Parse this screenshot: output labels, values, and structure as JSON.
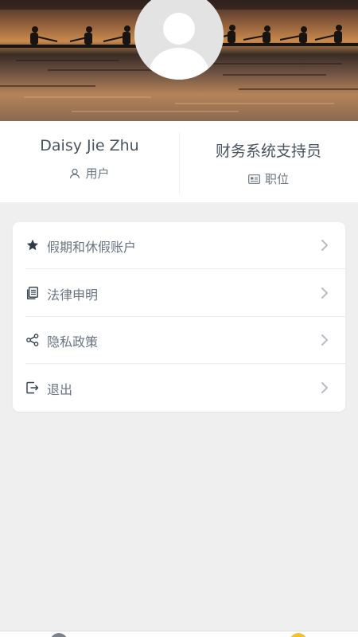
{
  "profile": {
    "name": "Daisy Jie Zhu",
    "name_caption": "用户",
    "position": "财务系统支持员",
    "position_caption": "职位"
  },
  "menu": {
    "items": [
      {
        "label": "假期和休假账户",
        "icon": "star-icon"
      },
      {
        "label": "法律申明",
        "icon": "document-icon"
      },
      {
        "label": "隐私政策",
        "icon": "share-icon"
      },
      {
        "label": "退出",
        "icon": "logout-icon"
      }
    ]
  },
  "colors": {
    "page_background": "#efefef",
    "card_background": "#ffffff",
    "text_primary": "#4a5360",
    "text_secondary": "#6a7480",
    "icon_dark": "#2f3a46",
    "tab_active": "#f2c12e"
  }
}
